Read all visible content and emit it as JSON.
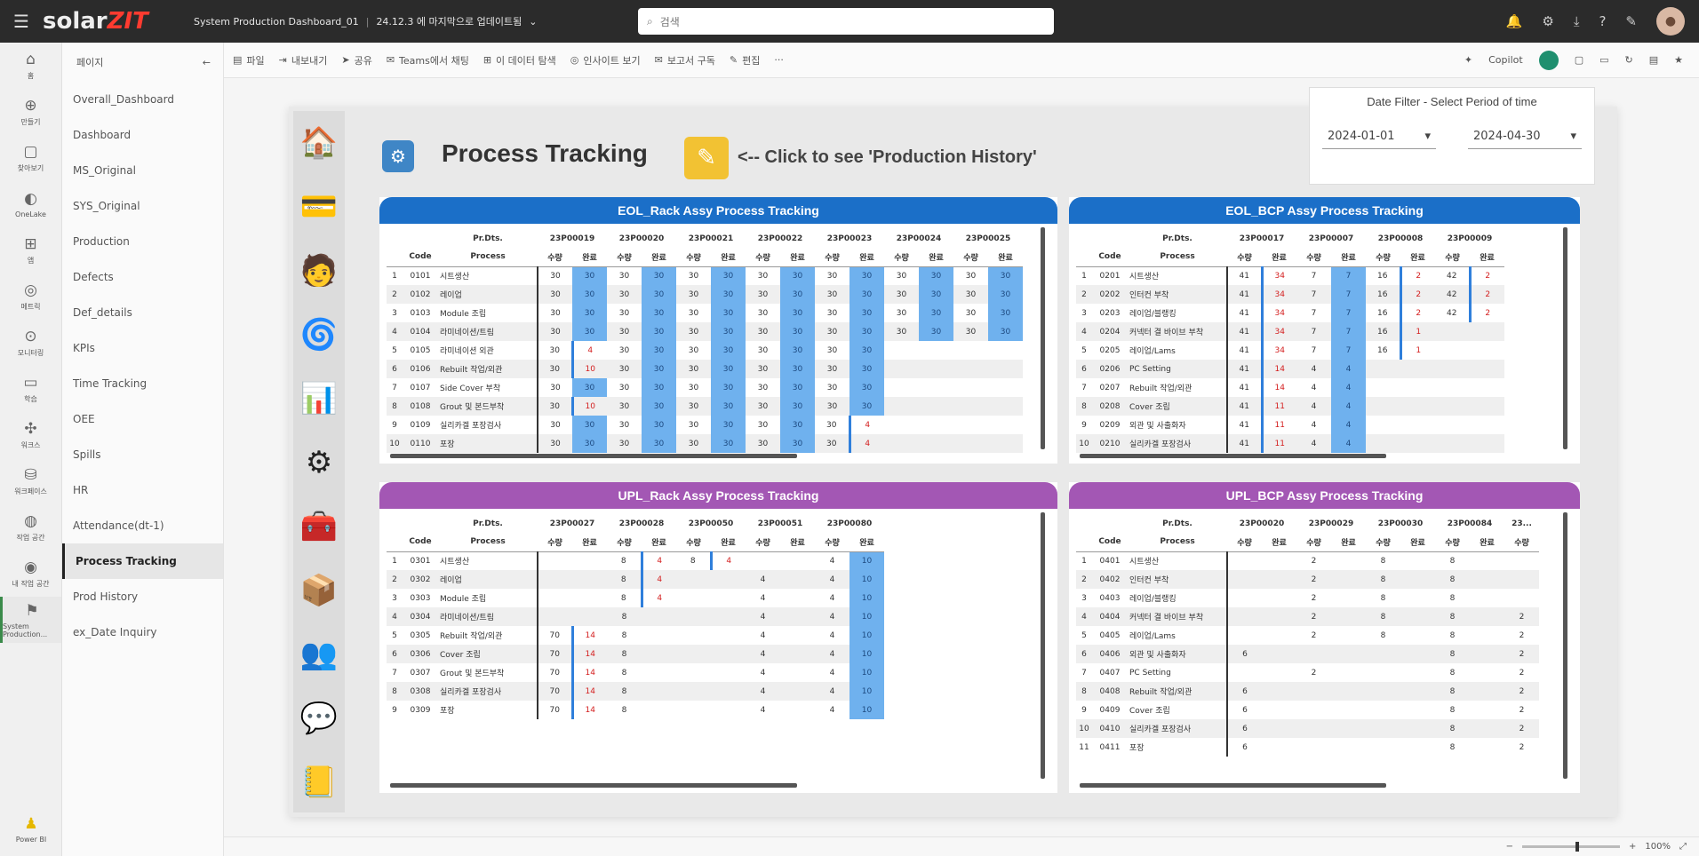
{
  "app": {
    "breadcrumb_title": "System Production Dashboard_01",
    "breadcrumb_sub": "24.12.3 에 마지막으로 업데이트됨",
    "search_placeholder": "검색",
    "logo_a": "solar",
    "logo_b": "ZIT"
  },
  "rail": [
    {
      "icon": "⌂",
      "label": "홈"
    },
    {
      "icon": "⊕",
      "label": "만들기"
    },
    {
      "icon": "▢",
      "label": "찾아보기"
    },
    {
      "icon": "◐",
      "label": "OneLake"
    },
    {
      "icon": "⊞",
      "label": "앱"
    },
    {
      "icon": "◎",
      "label": "메트릭"
    },
    {
      "icon": "⊙",
      "label": "모니터링"
    },
    {
      "icon": "▭",
      "label": "학습"
    },
    {
      "icon": "✣",
      "label": "워크스"
    },
    {
      "icon": "⛁",
      "label": "워크페이스"
    },
    {
      "icon": "◍",
      "label": "작업 공간"
    },
    {
      "icon": "◉",
      "label": "내 작업 공간"
    },
    {
      "icon": "⚑",
      "label": "System Production..."
    }
  ],
  "rail_bottom": {
    "icon": "♟",
    "label": "Power BI"
  },
  "pages": {
    "header": "페이지",
    "items": [
      "Overall_Dashboard",
      "Dashboard",
      "MS_Original",
      "SYS_Original",
      "Production",
      "Defects",
      "Def_details",
      "KPIs",
      "Time Tracking",
      "OEE",
      "Spills",
      "HR",
      "Attendance(dt-1)",
      "Process Tracking",
      "Prod History",
      "ex_Date Inquiry"
    ],
    "selected": 13
  },
  "toolbar": {
    "items": [
      "파일",
      "내보내기",
      "공유",
      "Teams에서 채팅",
      "이 데이터 탐색",
      "인사이트 보기",
      "보고서 구독",
      "편집"
    ],
    "copilot": "Copilot"
  },
  "report": {
    "title": "Process Tracking",
    "history_label": "<-- Click to see 'Production History'"
  },
  "nav_icons": [
    "🏠",
    "💳",
    "🧑",
    "🌀",
    "📊",
    "⚙",
    "🧰",
    "📦",
    "👥",
    "💬",
    "📒"
  ],
  "date_filter": {
    "title": "Date Filter - Select Period of time",
    "start": "2024-01-01",
    "end": "2024-04-30"
  },
  "status": {
    "zoom": "100%"
  },
  "panels": [
    {
      "key": "eol_rack",
      "title": "EOL_Rack Assy Process Tracking",
      "color": "blue",
      "lots": [
        "23P00019",
        "23P00020",
        "23P00021",
        "23P00022",
        "23P00023",
        "23P00024",
        "23P00025"
      ],
      "rows": [
        {
          "n": "1",
          "code": "0101",
          "proc": "시트생산",
          "c": [
            "30",
            "30",
            "30",
            "30",
            "30",
            "30",
            "30",
            "30",
            "30",
            "30",
            "30",
            "30",
            "30",
            "30"
          ]
        },
        {
          "n": "2",
          "code": "0102",
          "proc": "레이업",
          "c": [
            "30",
            "30",
            "30",
            "30",
            "30",
            "30",
            "30",
            "30",
            "30",
            "30",
            "30",
            "30",
            "30",
            "30"
          ]
        },
        {
          "n": "3",
          "code": "0103",
          "proc": "Module 조립",
          "c": [
            "30",
            "30",
            "30",
            "30",
            "30",
            "30",
            "30",
            "30",
            "30",
            "30",
            "30",
            "30",
            "30",
            "30"
          ]
        },
        {
          "n": "4",
          "code": "0104",
          "proc": "라미네이션/트림",
          "c": [
            "30",
            "30",
            "30",
            "30",
            "30",
            "30",
            "30",
            "30",
            "30",
            "30",
            "30",
            "30",
            "30",
            "30"
          ]
        },
        {
          "n": "5",
          "code": "0105",
          "proc": "라미네이션 외관",
          "c": [
            "30",
            "4",
            "30",
            "30",
            "30",
            "30",
            "30",
            "30",
            "30",
            "30",
            "",
            "",
            "",
            ""
          ]
        },
        {
          "n": "6",
          "code": "0106",
          "proc": "Rebuilt 작업/외관",
          "c": [
            "30",
            "10",
            "30",
            "30",
            "30",
            "30",
            "30",
            "30",
            "30",
            "30",
            "",
            "",
            "",
            ""
          ]
        },
        {
          "n": "7",
          "code": "0107",
          "proc": "Side Cover 부착",
          "c": [
            "30",
            "30",
            "30",
            "30",
            "30",
            "30",
            "30",
            "30",
            "30",
            "30",
            "",
            "",
            "",
            ""
          ]
        },
        {
          "n": "8",
          "code": "0108",
          "proc": "Grout 및 본드부착",
          "c": [
            "30",
            "10",
            "30",
            "30",
            "30",
            "30",
            "30",
            "30",
            "30",
            "30",
            "",
            "",
            "",
            ""
          ]
        },
        {
          "n": "9",
          "code": "0109",
          "proc": "실리카겔 포장검사",
          "c": [
            "30",
            "30",
            "30",
            "30",
            "30",
            "30",
            "30",
            "30",
            "30",
            "4",
            "",
            "",
            "",
            ""
          ]
        },
        {
          "n": "10",
          "code": "0110",
          "proc": "포장",
          "c": [
            "30",
            "30",
            "30",
            "30",
            "30",
            "30",
            "30",
            "30",
            "30",
            "4",
            "",
            "",
            "",
            ""
          ]
        }
      ]
    },
    {
      "key": "eol_bcp",
      "title": "EOL_BCP Assy Process Tracking",
      "color": "blue",
      "lots": [
        "23P00017",
        "23P00007",
        "23P00008",
        "23P00009"
      ],
      "rows": [
        {
          "n": "1",
          "code": "0201",
          "proc": "시트생산",
          "c": [
            "41",
            "34",
            "7",
            "7",
            "16",
            "2",
            "42",
            "2"
          ]
        },
        {
          "n": "2",
          "code": "0202",
          "proc": "인터컨 부착",
          "c": [
            "41",
            "34",
            "7",
            "7",
            "16",
            "2",
            "42",
            "2"
          ]
        },
        {
          "n": "3",
          "code": "0203",
          "proc": "레이업/블랭킹",
          "c": [
            "41",
            "34",
            "7",
            "7",
            "16",
            "2",
            "42",
            "2"
          ]
        },
        {
          "n": "4",
          "code": "0204",
          "proc": "커넥터 결 바이브 부착",
          "c": [
            "41",
            "34",
            "7",
            "7",
            "16",
            "1",
            "",
            ""
          ]
        },
        {
          "n": "5",
          "code": "0205",
          "proc": "레이업/Lams",
          "c": [
            "41",
            "34",
            "7",
            "7",
            "16",
            "1",
            "",
            ""
          ]
        },
        {
          "n": "6",
          "code": "0206",
          "proc": "PC Setting",
          "c": [
            "41",
            "14",
            "4",
            "4",
            "",
            "",
            "",
            ""
          ]
        },
        {
          "n": "7",
          "code": "0207",
          "proc": "Rebuilt 작업/외관",
          "c": [
            "41",
            "14",
            "4",
            "4",
            "",
            "",
            "",
            ""
          ]
        },
        {
          "n": "8",
          "code": "0208",
          "proc": "Cover 조립",
          "c": [
            "41",
            "11",
            "4",
            "4",
            "",
            "",
            "",
            ""
          ]
        },
        {
          "n": "9",
          "code": "0209",
          "proc": "외관 및 사출화자",
          "c": [
            "41",
            "11",
            "4",
            "4",
            "",
            "",
            "",
            ""
          ]
        },
        {
          "n": "10",
          "code": "0210",
          "proc": "실리카겔 포장검사",
          "c": [
            "41",
            "11",
            "4",
            "4",
            "",
            "",
            "",
            ""
          ]
        }
      ]
    },
    {
      "key": "upl_rack",
      "title": "UPL_Rack Assy Process Tracking",
      "color": "purple",
      "lots": [
        "23P00027",
        "23P00028",
        "23P00050",
        "23P00051",
        "23P00080"
      ],
      "rows": [
        {
          "n": "1",
          "code": "0301",
          "proc": "시트생산",
          "c": [
            "",
            "",
            "8",
            "4",
            "8",
            "4",
            "",
            "",
            "4",
            "10"
          ]
        },
        {
          "n": "2",
          "code": "0302",
          "proc": "레이업",
          "c": [
            "",
            "",
            "8",
            "4",
            "",
            "",
            "4",
            "",
            "4",
            "10"
          ]
        },
        {
          "n": "3",
          "code": "0303",
          "proc": "Module 조립",
          "c": [
            "",
            "",
            "8",
            "4",
            "",
            "",
            "4",
            "",
            "4",
            "10"
          ]
        },
        {
          "n": "4",
          "code": "0304",
          "proc": "라미네이션/트림",
          "c": [
            "",
            "",
            "8",
            "",
            "",
            "",
            "4",
            "",
            "4",
            "10"
          ]
        },
        {
          "n": "5",
          "code": "0305",
          "proc": "Rebuilt 작업/외관",
          "c": [
            "70",
            "14",
            "8",
            "",
            "",
            "",
            "4",
            "",
            "4",
            "10"
          ]
        },
        {
          "n": "6",
          "code": "0306",
          "proc": "Cover 조립",
          "c": [
            "70",
            "14",
            "8",
            "",
            "",
            "",
            "4",
            "",
            "4",
            "10"
          ]
        },
        {
          "n": "7",
          "code": "0307",
          "proc": "Grout 및 본드부착",
          "c": [
            "70",
            "14",
            "8",
            "",
            "",
            "",
            "4",
            "",
            "4",
            "10"
          ]
        },
        {
          "n": "8",
          "code": "0308",
          "proc": "실리카겔 포장검사",
          "c": [
            "70",
            "14",
            "8",
            "",
            "",
            "",
            "4",
            "",
            "4",
            "10"
          ]
        },
        {
          "n": "9",
          "code": "0309",
          "proc": "포장",
          "c": [
            "70",
            "14",
            "8",
            "",
            "",
            "",
            "4",
            "",
            "4",
            "10"
          ]
        }
      ]
    },
    {
      "key": "upl_bcp",
      "title": "UPL_BCP Assy Process Tracking",
      "color": "purple",
      "lots": [
        "23P00020",
        "23P00029",
        "23P00030",
        "23P00084",
        "23..."
      ],
      "rows": [
        {
          "n": "1",
          "code": "0401",
          "proc": "시트생산",
          "c": [
            "",
            "",
            "2",
            "",
            "8",
            "",
            "8",
            "",
            ""
          ]
        },
        {
          "n": "2",
          "code": "0402",
          "proc": "인터컨 부착",
          "c": [
            "",
            "",
            "2",
            "",
            "8",
            "",
            "8",
            "",
            ""
          ]
        },
        {
          "n": "3",
          "code": "0403",
          "proc": "레이업/블랭킹",
          "c": [
            "",
            "",
            "2",
            "",
            "8",
            "",
            "8",
            "",
            ""
          ]
        },
        {
          "n": "4",
          "code": "0404",
          "proc": "커넥터 결 바이브 부착",
          "c": [
            "",
            "",
            "2",
            "",
            "8",
            "",
            "8",
            "",
            "2"
          ]
        },
        {
          "n": "5",
          "code": "0405",
          "proc": "레이업/Lams",
          "c": [
            "",
            "",
            "2",
            "",
            "8",
            "",
            "8",
            "",
            "2"
          ]
        },
        {
          "n": "6",
          "code": "0406",
          "proc": "외관 및 사출화자",
          "c": [
            "6",
            "",
            "",
            "",
            "",
            "",
            "8",
            "",
            "2"
          ]
        },
        {
          "n": "7",
          "code": "0407",
          "proc": "PC Setting",
          "c": [
            "",
            "",
            "2",
            "",
            "",
            "",
            "8",
            "",
            "2"
          ]
        },
        {
          "n": "8",
          "code": "0408",
          "proc": "Rebuilt 작업/외관",
          "c": [
            "6",
            "",
            "",
            "",
            "",
            "",
            "8",
            "",
            "2"
          ]
        },
        {
          "n": "9",
          "code": "0409",
          "proc": "Cover 조립",
          "c": [
            "6",
            "",
            "",
            "",
            "",
            "",
            "8",
            "",
            "2"
          ]
        },
        {
          "n": "10",
          "code": "0410",
          "proc": "실리카겔 포장검사",
          "c": [
            "6",
            "",
            "",
            "",
            "",
            "",
            "8",
            "",
            "2"
          ]
        },
        {
          "n": "11",
          "code": "0411",
          "proc": "포장",
          "c": [
            "6",
            "",
            "",
            "",
            "",
            "",
            "8",
            "",
            "2"
          ]
        }
      ]
    }
  ],
  "table_labels": {
    "lot": "Pr.Dts.",
    "code": "Code",
    "process": "Process",
    "qty": "수량",
    "done": "완료"
  }
}
